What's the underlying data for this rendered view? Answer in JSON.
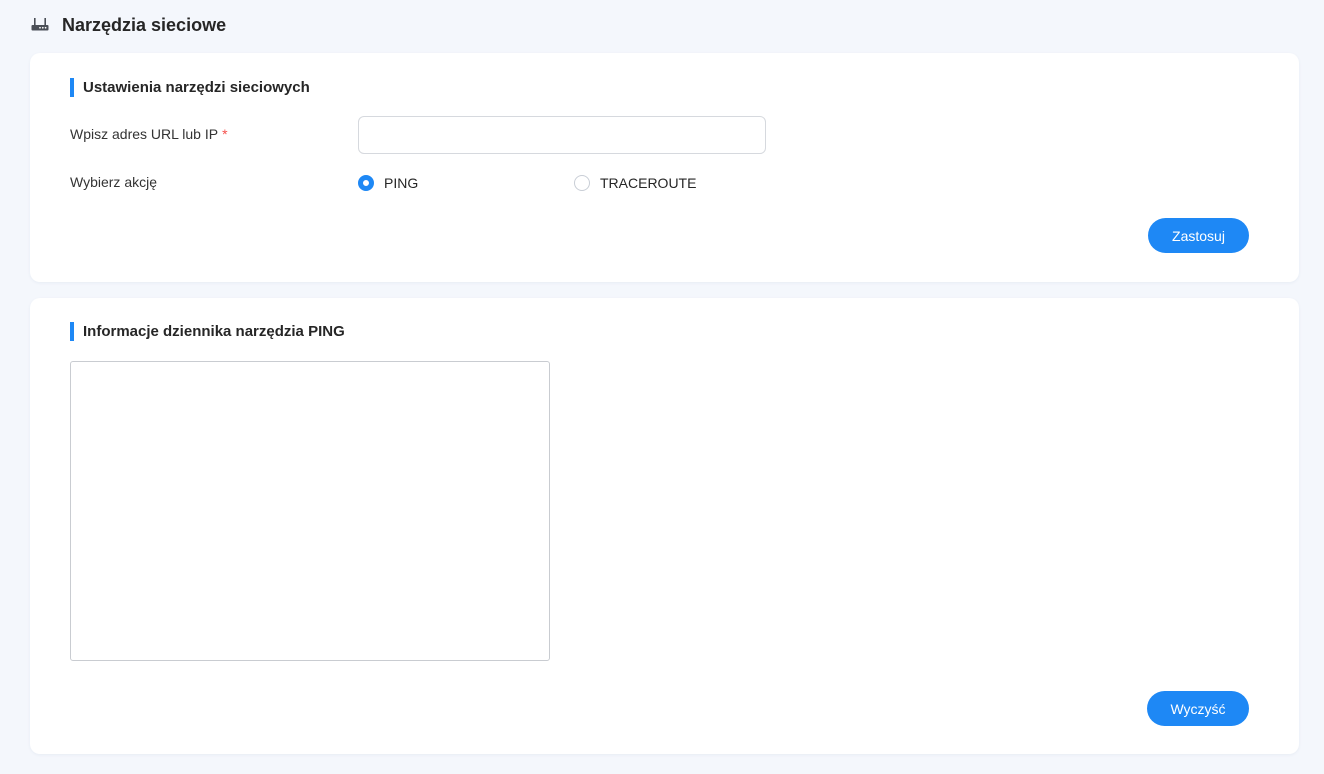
{
  "header": {
    "icon": "router-icon",
    "title": "Narzędzia sieciowe"
  },
  "settings": {
    "section_title": "Ustawienia narzędzi sieciowych",
    "url_label": "Wpisz adres URL lub IP",
    "required_mark": "*",
    "url_value": "",
    "action_label": "Wybierz akcję",
    "actions": [
      {
        "label": "PING",
        "selected": true
      },
      {
        "label": "TRACEROUTE",
        "selected": false
      }
    ],
    "apply_label": "Zastosuj"
  },
  "log": {
    "section_title": "Informacje dziennika narzędzia PING",
    "content": "",
    "clear_label": "Wyczyść"
  },
  "colors": {
    "accent": "#1e88f5",
    "background": "#f4f7fc",
    "required": "#f5504c"
  }
}
